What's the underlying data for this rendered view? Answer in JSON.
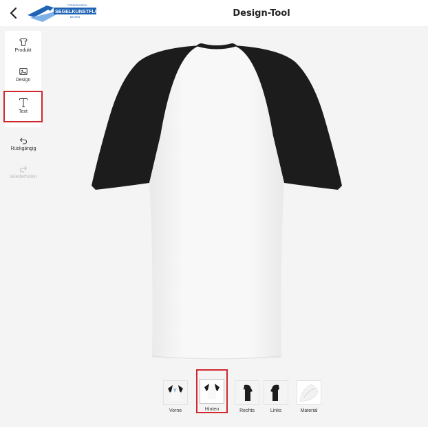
{
  "header": {
    "title": "Design-Tool",
    "logo_text": "SEGELKUNSTFLUG",
    "logo_subtext": "FÖRDERVEREIN",
    "logo_tag": "BAYERN"
  },
  "sidebar": {
    "tools": [
      {
        "label": "Produkt",
        "icon": "tshirt-icon"
      },
      {
        "label": "Design",
        "icon": "image-icon"
      },
      {
        "label": "Text",
        "icon": "text-icon",
        "selected": true
      }
    ],
    "history": [
      {
        "label": "Rückgängig",
        "icon": "undo-icon",
        "enabled": true
      },
      {
        "label": "Wiederholen",
        "icon": "redo-icon",
        "enabled": false
      }
    ]
  },
  "product": {
    "body_color": "#f7f7f7",
    "sleeve_color": "#1c1c1c",
    "current_view": "Hinten"
  },
  "views": [
    {
      "label": "Vorne"
    },
    {
      "label": "Hinten",
      "selected": true
    },
    {
      "label": "Rechts"
    },
    {
      "label": "Links"
    },
    {
      "label": "Material"
    }
  ],
  "colors": {
    "highlight": "#d0262c",
    "logo_blue": "#1f63b4"
  }
}
